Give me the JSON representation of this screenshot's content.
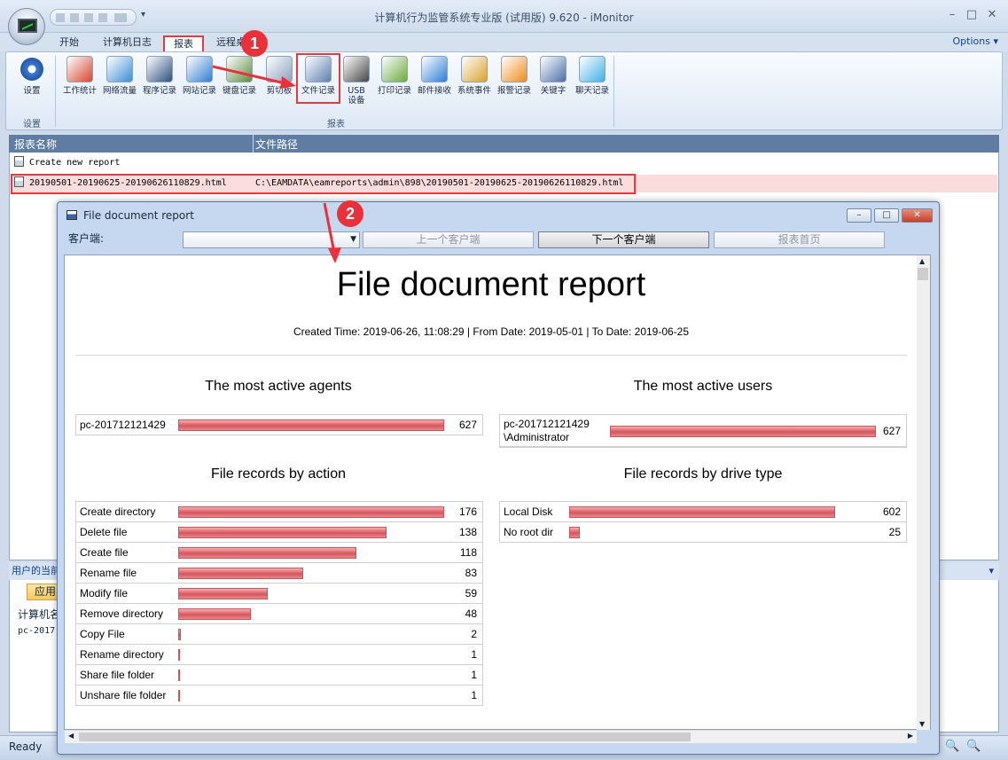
{
  "window": {
    "title": "计算机行为监管系统专业版 (试用版) 9.620 - iMonitor",
    "options_label": "Options",
    "ribbon_tabs": [
      "开始",
      "计算机日志",
      "报表",
      "远程桌"
    ],
    "groups": {
      "settings": "设置",
      "reports": "报表"
    },
    "settings_button": "设置",
    "report_buttons": [
      "工作统计",
      "网络流量",
      "程序记录",
      "网站记录",
      "键盘记录",
      "剪切板",
      "文件记录",
      "USB\n设备",
      "打印记录",
      "邮件接收",
      "系统事件",
      "报警记录",
      "关键字",
      "聊天记录"
    ]
  },
  "list": {
    "columns": [
      "报表名称",
      "文件路径"
    ],
    "rows": [
      {
        "name": "Create new report",
        "path": ""
      },
      {
        "name": "20190501-20190625-20190626110829.html",
        "path": "C:\\EAMDATA\\eamreports\\admin\\898\\20190501-20190625-20190626110829.html"
      }
    ]
  },
  "bottom_panel": {
    "title": "用户的当前",
    "tab": "应用",
    "column": "计算机名",
    "row": "pc-2017"
  },
  "status": {
    "text": "Ready"
  },
  "annotations": [
    "1",
    "2"
  ],
  "dialog": {
    "title": "File document report",
    "client_label": "客户端:",
    "prev_label": "上一个客户端",
    "next_label": "下一个客户端",
    "home_label": "报表首页",
    "report": {
      "title": "File document report",
      "subtitle": "Created Time: 2019-06-26, 11:08:29 | From Date: 2019-05-01 | To Date: 2019-06-25",
      "agents": {
        "heading": "The most active agents",
        "rows": [
          {
            "name": "pc-201712121429",
            "value": 627
          }
        ]
      },
      "users": {
        "heading": "The most active users",
        "rows": [
          {
            "name": "pc-201712121429\n\\Administrator",
            "value": 627
          }
        ]
      },
      "by_action": {
        "heading": "File records by action",
        "rows": [
          {
            "name": "Create directory",
            "value": 176
          },
          {
            "name": "Delete file",
            "value": 138
          },
          {
            "name": "Create file",
            "value": 118
          },
          {
            "name": "Rename file",
            "value": 83
          },
          {
            "name": "Modify file",
            "value": 59
          },
          {
            "name": "Remove directory",
            "value": 48
          },
          {
            "name": "Copy File",
            "value": 2
          },
          {
            "name": "Rename directory",
            "value": 1
          },
          {
            "name": "Share file folder",
            "value": 1
          },
          {
            "name": "Unshare file folder",
            "value": 1
          }
        ]
      },
      "by_drive": {
        "heading": "File records by drive type",
        "rows": [
          {
            "name": "Local Disk",
            "value": 602
          },
          {
            "name": "No root dir",
            "value": 25
          }
        ]
      }
    }
  },
  "colors": {
    "accent_red": "#e8313a",
    "bar": "#d9545c",
    "header_blue": "#5f7da3"
  }
}
